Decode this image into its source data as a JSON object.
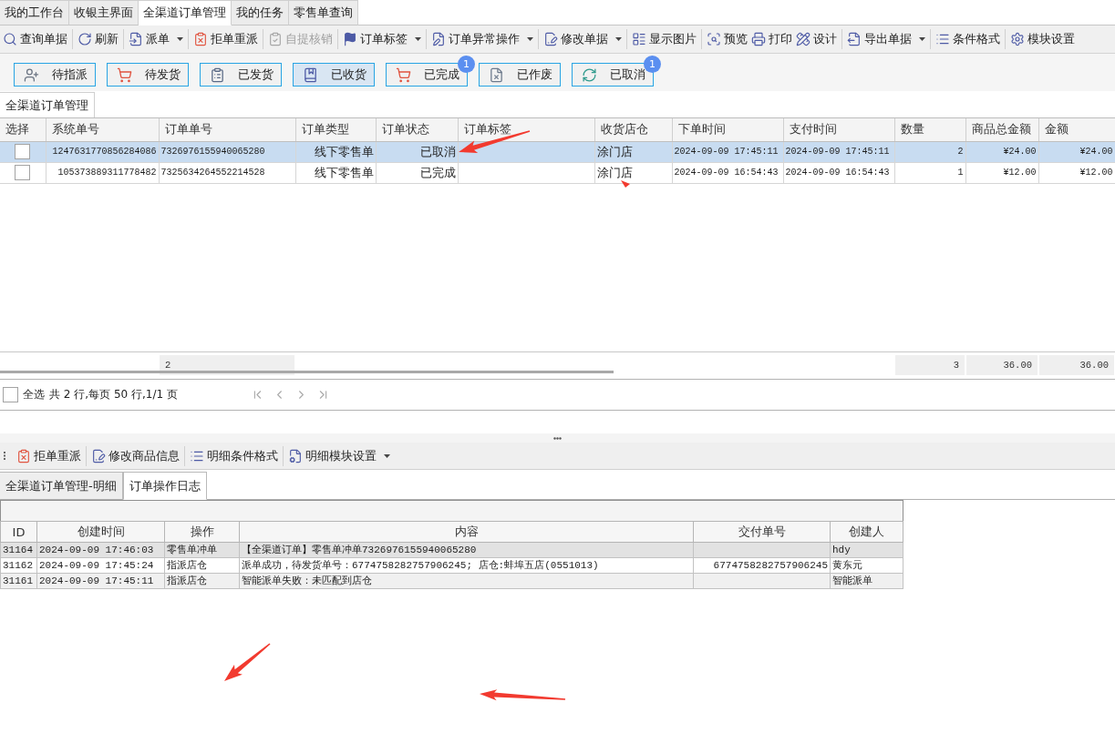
{
  "app_tabs": [
    {
      "label": "我的工作台",
      "selected": false
    },
    {
      "label": "收银主界面",
      "selected": false
    },
    {
      "label": "全渠道订单管理",
      "selected": true
    },
    {
      "label": "我的任务",
      "selected": false
    },
    {
      "label": "零售单查询",
      "selected": false
    }
  ],
  "toolbar": {
    "groups": [
      [
        {
          "label": "查询单据",
          "disabled": false,
          "menu": false
        }
      ],
      [
        {
          "label": "刷新",
          "disabled": false,
          "menu": false
        }
      ],
      [
        {
          "label": "派单",
          "disabled": false,
          "menu": true
        }
      ],
      [
        {
          "label": "拒单重派",
          "disabled": false,
          "menu": false
        }
      ],
      [
        {
          "label": "自提核销",
          "disabled": true,
          "menu": false
        }
      ],
      [
        {
          "label": "订单标签",
          "disabled": false,
          "menu": true
        }
      ],
      [
        {
          "label": "订单异常操作",
          "disabled": false,
          "menu": true
        }
      ],
      [
        {
          "label": "修改单据",
          "disabled": false,
          "menu": true
        }
      ],
      [
        {
          "label": "显示图片",
          "disabled": false,
          "menu": false
        }
      ],
      [
        {
          "label": "预览",
          "disabled": false,
          "menu": false
        },
        {
          "label": "打印",
          "disabled": false,
          "menu": false
        },
        {
          "label": "设计",
          "disabled": false,
          "menu": false
        }
      ],
      [
        {
          "label": "导出单据",
          "disabled": false,
          "menu": true
        }
      ],
      [
        {
          "label": "条件格式",
          "disabled": false,
          "menu": false
        }
      ],
      [
        {
          "label": "模块设置",
          "disabled": false,
          "menu": false
        }
      ]
    ]
  },
  "status_filters": [
    {
      "label": "待指派",
      "selected": false
    },
    {
      "label": "待发货",
      "selected": false
    },
    {
      "label": "已发货",
      "selected": false
    },
    {
      "label": "已收货",
      "selected": true
    },
    {
      "label": "已完成",
      "selected": false,
      "badge": "1"
    },
    {
      "label": "已作废",
      "selected": false
    },
    {
      "label": "已取消",
      "selected": false,
      "badge": "1"
    }
  ],
  "section_tab": {
    "label": "全渠道订单管理"
  },
  "orders_table": {
    "columns": [
      "选择",
      "系统单号",
      "订单单号",
      "订单类型",
      "订单状态",
      "订单标签",
      "收货店仓",
      "下单时间",
      "支付时间",
      "数量",
      "商品总金额",
      "金额"
    ],
    "rows": [
      {
        "selected": true,
        "checked": false,
        "system_no": "1247631770856284086",
        "order_no": "7326976155940065280",
        "order_type": "线下零售单",
        "order_status": "已取消",
        "store": "涂门店",
        "order_time": "2024-09-09 17:45:11",
        "pay_time": "2024-09-09 17:45:11",
        "quantity": "2",
        "goods_total": "¥24.00",
        "amount": "¥24.00"
      },
      {
        "selected": false,
        "checked": false,
        "system_no": "105373889311778482",
        "order_no": "7325634264552214528",
        "order_type": "线下零售单",
        "order_status": "已完成",
        "store": "涂门店",
        "order_time": "2024-09-09 16:54:43",
        "pay_time": "2024-09-09 16:54:43",
        "quantity": "1",
        "goods_total": "¥12.00",
        "amount": "¥12.00"
      }
    ],
    "summary": {
      "row_count": "2",
      "quantity": "3",
      "goods_total": "36.00",
      "amount": "36.00"
    }
  },
  "pager": {
    "select_all": {
      "label": "全选",
      "checked": false
    },
    "info": "共 2 行,每页 50 行,1/1 页"
  },
  "detail_toolbar": [
    {
      "label": "拒单重派",
      "menu": false
    },
    {
      "label": "修改商品信息",
      "menu": false
    },
    {
      "label": "明细条件格式",
      "menu": false
    },
    {
      "label": "明细模块设置",
      "menu": true
    }
  ],
  "detail_tabs": [
    {
      "label": "全渠道订单管理-明细",
      "selected": false
    },
    {
      "label": "订单操作日志",
      "selected": true
    }
  ],
  "log_table": {
    "columns": [
      "ID",
      "创建时间",
      "操作",
      "内容",
      "交付单号",
      "创建人"
    ],
    "rows": [
      {
        "selected": true,
        "id": "31164",
        "created_at": "2024-09-09 17:46:03",
        "operation": "零售单冲单",
        "content": "【全渠道订单】零售单冲单7326976155940065280",
        "creator": "hdy"
      },
      {
        "selected": false,
        "id": "31162",
        "created_at": "2024-09-09 17:45:24",
        "operation": "指派店仓",
        "content": "派单成功，待发货单号：6774758282757906245; 店仓:蚌埠五店(0551013)",
        "delivery_no": "6774758282757906245",
        "creator": "黄东元"
      },
      {
        "selected": false,
        "id": "31161",
        "created_at": "2024-09-09 17:45:11",
        "operation": "指派店仓",
        "content": "智能派单失败：未匹配到店仓",
        "creator": "智能派单"
      }
    ]
  }
}
